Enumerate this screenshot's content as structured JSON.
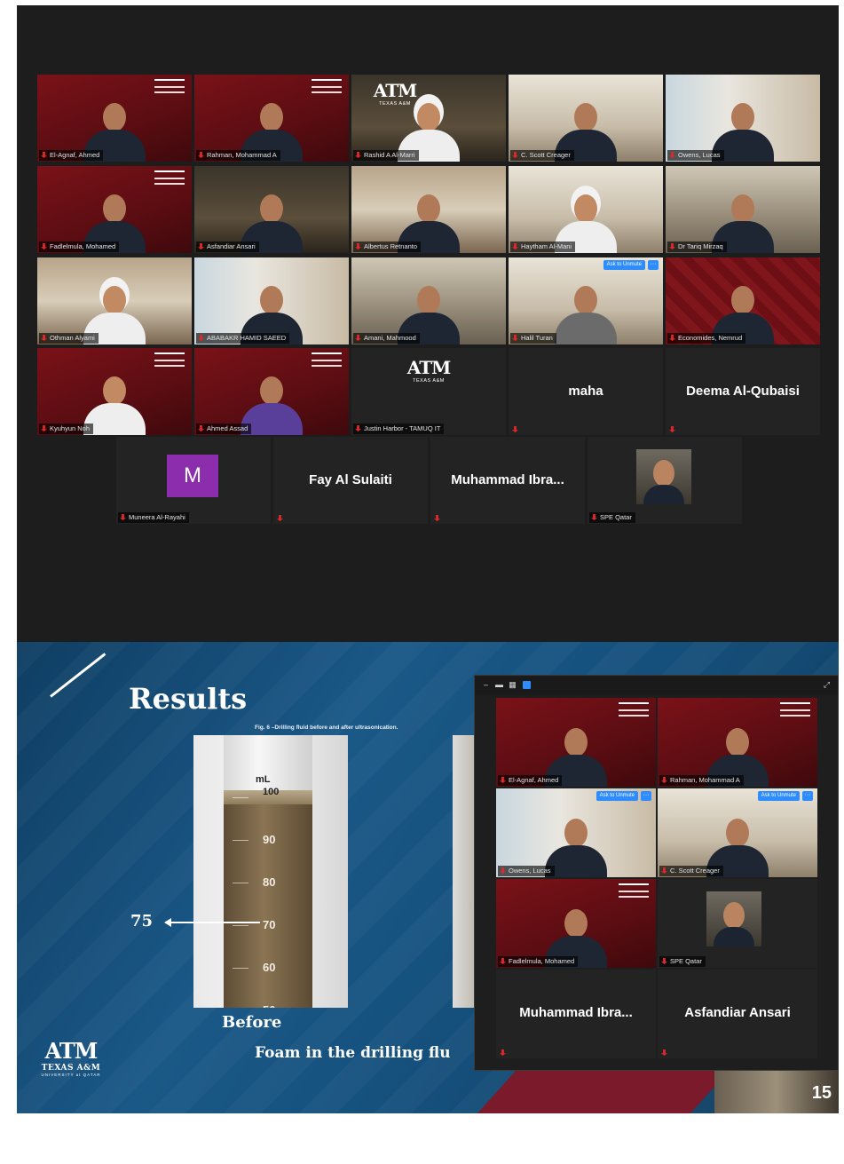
{
  "gallery": {
    "tiles": [
      {
        "label": "El-Agnaf, Ahmed",
        "type": "video",
        "bg": "maroon",
        "logo": true
      },
      {
        "label": "Rahman, Mohammad A",
        "type": "video",
        "bg": "maroon",
        "logo": true,
        "active": true
      },
      {
        "label": "Rashid A Al-Marri",
        "type": "video",
        "bg": "dark",
        "tamu": true
      },
      {
        "label": "C. Scott Creager",
        "type": "video",
        "bg": "light"
      },
      {
        "label": "Owens, Lucas",
        "type": "video",
        "bg": "window"
      },
      {
        "label": "Fadlelmula, Mohamed",
        "type": "video",
        "bg": "maroon",
        "logo": true
      },
      {
        "label": "Asfandiar Ansari",
        "type": "video",
        "bg": "dark"
      },
      {
        "label": "Albertus Retnanto",
        "type": "video",
        "bg": "office"
      },
      {
        "label": "Haytham Al-Mani",
        "type": "video",
        "bg": "light"
      },
      {
        "label": "Dr Tariq Mirzaq",
        "type": "video",
        "bg": "room"
      },
      {
        "label": "Othman Alyami",
        "type": "video",
        "bg": "office"
      },
      {
        "label": "ABABAKR HAMID SAEED",
        "type": "video",
        "bg": "window"
      },
      {
        "label": "Amani, Mahmood",
        "type": "video",
        "bg": "room"
      },
      {
        "label": "Halil Turan",
        "type": "video",
        "bg": "light",
        "askUnmute": true
      },
      {
        "label": "Economides, Nemrud",
        "type": "video",
        "bg": "pattern"
      },
      {
        "label": "Kyuhyun Noh",
        "type": "video",
        "bg": "maroon",
        "logo": true
      },
      {
        "label": "Ahmed Assad",
        "type": "video",
        "bg": "maroon",
        "logo": true
      },
      {
        "label": "Justin Harbor - TAMUQ IT",
        "type": "tamu"
      },
      {
        "name": "maha",
        "type": "name"
      },
      {
        "name": "Deema Al-Qubaisi",
        "type": "name"
      },
      {
        "label": "Muneera Al-Rayahi",
        "type": "avatar",
        "initial": "M"
      },
      {
        "name": "Fay Al Sulaiti",
        "type": "name"
      },
      {
        "name": "Muhammad  Ibra...",
        "type": "name"
      },
      {
        "label": "SPE Qatar",
        "type": "photo"
      }
    ],
    "ask_unmute_label": "Ask to Unmute",
    "more_label": "···",
    "tamu_logo_mark": "ATM",
    "tamu_logo_sub": "TEXAS A&M"
  },
  "slide": {
    "title": "Results",
    "fig_caption": "Fig. 6 –Drilling fluid before and after ultrasonication.",
    "value_marker": "75",
    "before_label": "Before",
    "foam_caption": "Foam in the drilling flu",
    "slide_number": "15",
    "logo_mark": "ATM",
    "logo_name": "TEXAS A&M",
    "logo_uni": "UNIVERSITY at QATAR",
    "cylinder_scale": [
      "100",
      "90",
      "80",
      "70",
      "60",
      "50"
    ],
    "cylinder_unit": "mL"
  },
  "float_panel": {
    "tiles": [
      {
        "label": "El-Agnaf, Ahmed",
        "type": "video",
        "bg": "maroon",
        "logo": true,
        "active": true
      },
      {
        "label": "Rahman, Mohammad A",
        "type": "video",
        "bg": "maroon",
        "logo": true
      },
      {
        "label": "Owens, Lucas",
        "type": "video",
        "bg": "window",
        "askUnmute": true
      },
      {
        "label": "C. Scott Creager",
        "type": "video",
        "bg": "light",
        "askUnmute": true
      },
      {
        "label": "Fadlelmula, Mohamed",
        "type": "video",
        "bg": "maroon",
        "logo": true
      },
      {
        "label": "SPE Qatar",
        "type": "photo"
      },
      {
        "name": "Muhammad  Ibra...",
        "type": "name"
      },
      {
        "name": "Asfandiar Ansari",
        "type": "name"
      }
    ],
    "toolbar": {
      "minimize": "–",
      "hide": "▬",
      "view": "▦",
      "speaker": "■",
      "expand": "⤢"
    }
  },
  "colors": {
    "zoom_bg": "#1d1d1d",
    "tile_bg": "#232323",
    "active_speaker": "#d2d64a",
    "mute_red": "#e02828",
    "zoom_blue": "#2d8cff",
    "slide_blue": "#1a5887",
    "maroon": "#6a0f15"
  }
}
